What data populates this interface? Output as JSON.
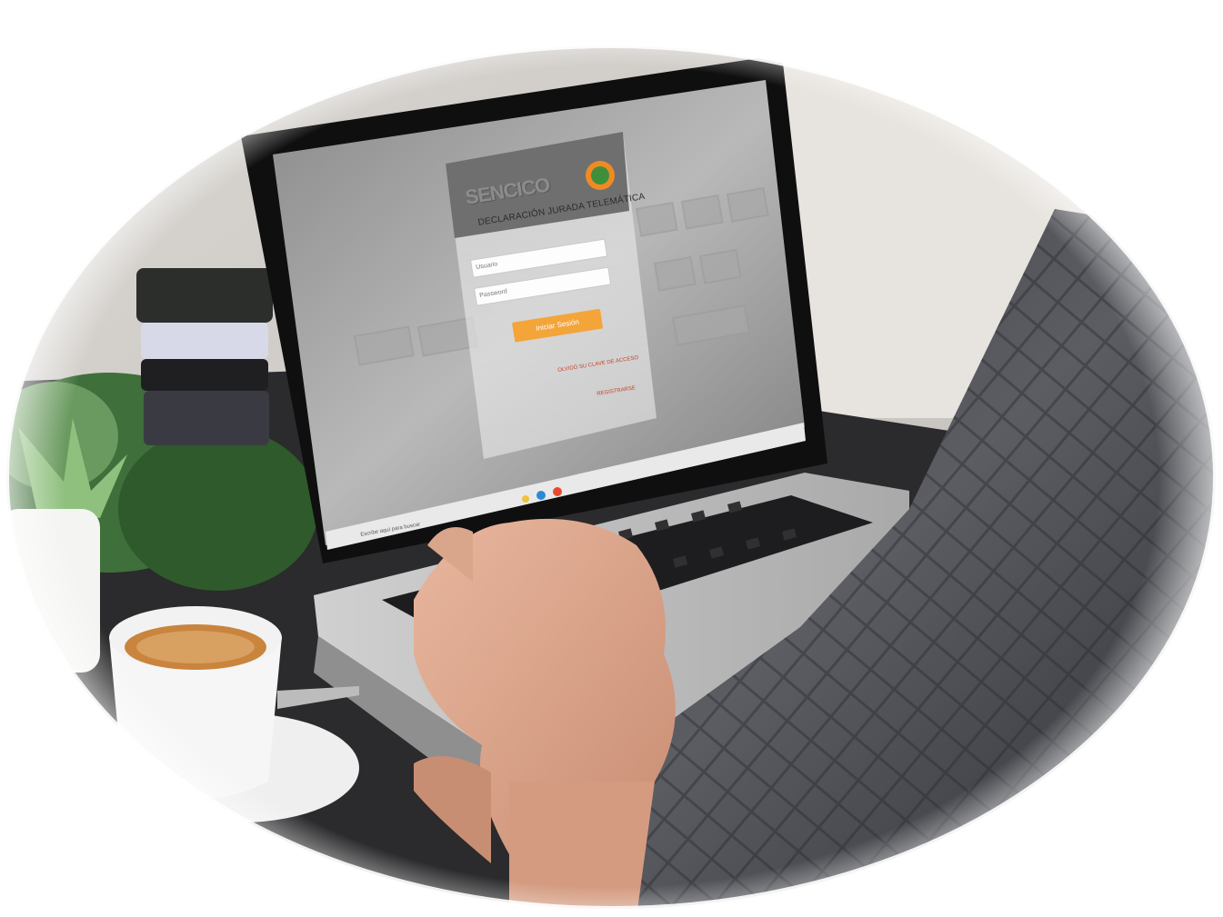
{
  "scene": {
    "description_icon": "photo-icon",
    "colors": {
      "frame_bg": "#ffffff",
      "login_button": "#f3a53a",
      "link_text": "#c8442a"
    }
  },
  "screen": {
    "brand": "SENCICO",
    "form_title": "DECLARACIÓN JURADA TELEMÁTICA",
    "username_placeholder": "Usuario",
    "password_placeholder": "Password",
    "login_button": "Iniciar Sesión",
    "forgot_link": "OLVIDÓ SU CLAVE DE ACCESO",
    "register_link": "REGISTRARSE",
    "taskbar_search": "Escribe aquí para buscar"
  }
}
